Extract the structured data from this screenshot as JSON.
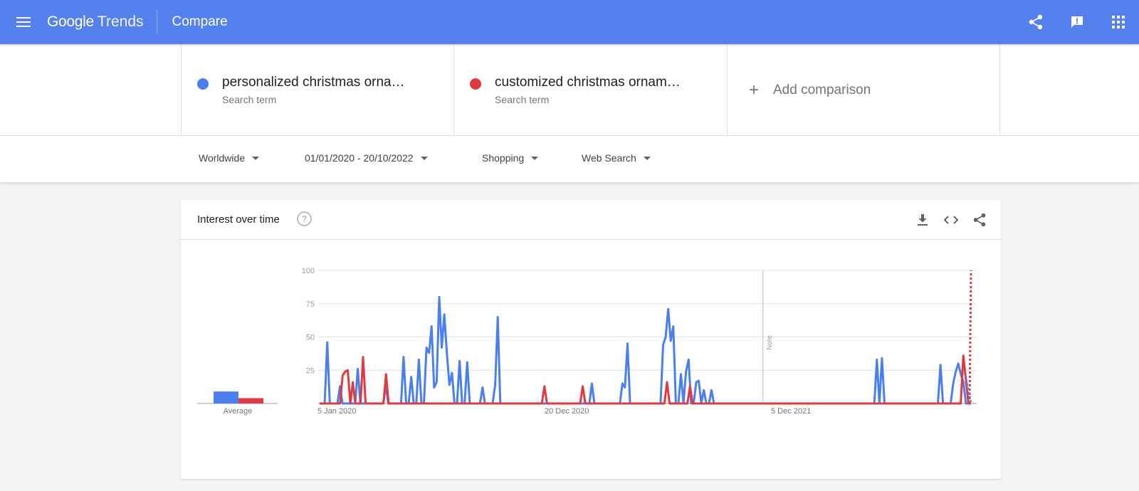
{
  "appbar": {
    "brand_google": "Google",
    "brand_trends": "Trends",
    "title": "Compare",
    "color": "#5581ef"
  },
  "terms": [
    {
      "name": "personalized christmas orna…",
      "sub": "Search term",
      "color": "#4a7ff0"
    },
    {
      "name": "customized christmas ornam…",
      "sub": "Search term",
      "color": "#e0393e"
    }
  ],
  "add_comparison": "Add comparison",
  "filters": {
    "region": "Worldwide",
    "date_range": "01/01/2020 - 20/10/2022",
    "category": "Shopping",
    "search_type": "Web Search"
  },
  "card": {
    "title": "Interest over time",
    "help_icon_glyph": "?",
    "average_label": "Average",
    "note_label": "Note"
  },
  "chart_data": {
    "type": "line",
    "ylim": [
      0,
      100
    ],
    "yticks": [
      "100",
      "75",
      "50",
      "25"
    ],
    "xticks": [
      "5 Jan 2020",
      "20 Dec 2020",
      "5 Dec 2021"
    ],
    "note_x": 0.71,
    "averages": [
      9,
      4
    ],
    "series": [
      {
        "color": "#4a7ff0",
        "values": [
          0,
          0,
          0,
          46,
          0,
          0,
          0,
          0,
          13,
          0,
          0,
          0,
          0,
          0,
          0,
          26,
          0,
          0,
          0,
          0,
          0,
          0,
          0,
          0,
          0,
          0,
          14,
          0,
          0,
          0,
          0,
          0,
          0,
          35,
          0,
          0,
          20,
          0,
          0,
          33,
          0,
          0,
          42,
          38,
          58,
          12,
          16,
          80,
          42,
          67,
          38,
          14,
          23,
          0,
          0,
          32,
          0,
          0,
          31,
          0,
          0,
          0,
          0,
          0,
          12,
          0,
          0,
          0,
          0,
          14,
          65,
          0,
          0,
          0,
          0,
          0,
          0,
          0,
          0,
          0,
          0,
          0,
          0,
          0,
          0,
          0,
          0,
          0,
          0,
          0,
          0,
          0,
          0,
          0,
          0,
          0,
          0,
          0,
          0,
          0,
          0,
          0,
          0,
          0,
          0,
          0,
          0,
          15,
          0,
          0,
          0,
          0,
          0,
          0,
          0,
          0,
          0,
          0,
          0,
          15,
          12,
          45,
          0,
          0,
          0,
          0,
          0,
          0,
          0,
          0,
          0,
          0,
          0,
          0,
          0,
          44,
          50,
          71,
          47,
          58,
          0,
          0,
          22,
          0,
          24,
          33,
          0,
          0,
          16,
          17,
          0,
          10,
          0,
          0,
          10,
          0,
          0,
          0,
          0,
          0,
          0,
          0,
          0,
          0,
          0,
          0,
          0,
          0,
          0,
          0,
          0,
          0,
          0,
          0,
          0,
          0,
          0,
          0,
          0,
          0,
          0,
          0,
          0,
          0,
          0,
          0,
          0,
          0,
          0,
          0,
          0,
          0,
          0,
          0,
          0,
          0,
          0,
          0,
          0,
          0,
          0,
          0,
          0,
          0,
          0,
          0,
          0,
          0,
          0,
          0,
          0,
          0,
          0,
          0,
          0,
          0,
          0,
          0,
          0,
          33,
          0,
          34,
          0,
          0,
          0,
          0,
          0,
          0,
          0,
          0,
          0,
          0,
          0,
          0,
          0,
          0,
          0,
          0,
          0,
          0,
          0,
          0,
          0,
          0,
          29,
          0,
          0,
          0,
          0,
          15,
          24,
          30,
          22,
          16,
          0,
          0,
          0
        ]
      },
      {
        "color": "#e0393e",
        "values": [
          0,
          0,
          0,
          0,
          0,
          0,
          0,
          0,
          0,
          21,
          24,
          25,
          0,
          16,
          0,
          0,
          0,
          35,
          0,
          0,
          0,
          0,
          0,
          0,
          0,
          0,
          22,
          0,
          0,
          0,
          0,
          0,
          0,
          0,
          0,
          0,
          0,
          0,
          0,
          0,
          0,
          0,
          0,
          0,
          0,
          0,
          0,
          0,
          0,
          0,
          0,
          0,
          0,
          0,
          0,
          0,
          0,
          0,
          0,
          0,
          0,
          0,
          0,
          0,
          0,
          0,
          0,
          0,
          0,
          0,
          0,
          0,
          0,
          0,
          0,
          0,
          0,
          0,
          0,
          0,
          0,
          0,
          0,
          0,
          0,
          0,
          0,
          0,
          13,
          0,
          0,
          0,
          0,
          0,
          0,
          0,
          0,
          0,
          0,
          0,
          0,
          0,
          0,
          13,
          0,
          0,
          0,
          0,
          0,
          0,
          0,
          0,
          0,
          0,
          0,
          0,
          0,
          0,
          0,
          0,
          0,
          0,
          0,
          0,
          0,
          0,
          0,
          0,
          0,
          0,
          0,
          0,
          0,
          0,
          0,
          0,
          16,
          0,
          0,
          0,
          0,
          0,
          0,
          0,
          0,
          13,
          0,
          0,
          0,
          0,
          0,
          0,
          0,
          0,
          0,
          0,
          0,
          0,
          0,
          0,
          0,
          0,
          0,
          0,
          0,
          0,
          0,
          0,
          0,
          0,
          0,
          0,
          0,
          0,
          0,
          0,
          0,
          0,
          0,
          0,
          0,
          0,
          0,
          0,
          0,
          0,
          0,
          0,
          0,
          0,
          0,
          0,
          0,
          0,
          0,
          0,
          0,
          0,
          0,
          0,
          0,
          0,
          0,
          0,
          0,
          0,
          0,
          0,
          0,
          0,
          0,
          0,
          0,
          0,
          0,
          0,
          0,
          0,
          0,
          0,
          0,
          0,
          0,
          0,
          0,
          0,
          0,
          0,
          0,
          0,
          0,
          0,
          0,
          0,
          0,
          0,
          0,
          0,
          0,
          0,
          0,
          0,
          0,
          0,
          0,
          0,
          0,
          0,
          0,
          0,
          0,
          0,
          36,
          18,
          0,
          0
        ]
      }
    ]
  }
}
